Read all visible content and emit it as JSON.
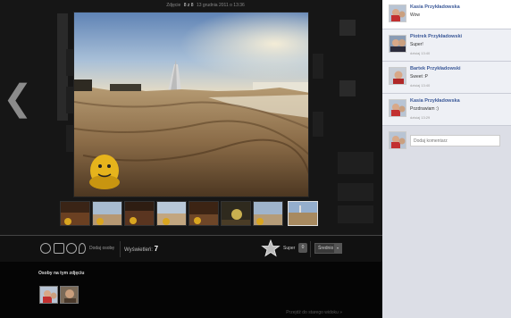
{
  "viewer": {
    "photo_info_prefix": "Zdjęcie",
    "photo_info_num": "8 z 8",
    "photo_info_date": "13 grudnia 2011 o 13:36",
    "prev_arrow": "❮",
    "old_site_link": "Przejdź do starego widoku »"
  },
  "toolbar": {
    "add_person_label": "Dodaj osobę",
    "views_label": "Wyświetleń:",
    "views_count": "7",
    "super_label": "Super",
    "super_count": "0",
    "rating_value": "Średnio"
  },
  "people": {
    "title": "Osoby na tym zdjęciu"
  },
  "comments": [
    {
      "name": "Kasia Przykładowska",
      "text": "Wow",
      "time": ""
    },
    {
      "name": "Piotrek Przykładowski",
      "text": "Super!",
      "time": "dzisiaj 13:40"
    },
    {
      "name": "Bartek Przykładowski",
      "text": "Sweet :P",
      "time": "dzisiaj 13:40"
    },
    {
      "name": "Kasia Przykładowska",
      "text": "Pozdrawiam :)",
      "time": "dzisiaj 13:29"
    }
  ],
  "comment_box": {
    "placeholder": "Dodaj komentarz"
  },
  "colors": {
    "comment_name": "#3b5998",
    "panel_bg": "#dcdee6",
    "viewer_bg": "#161616"
  }
}
